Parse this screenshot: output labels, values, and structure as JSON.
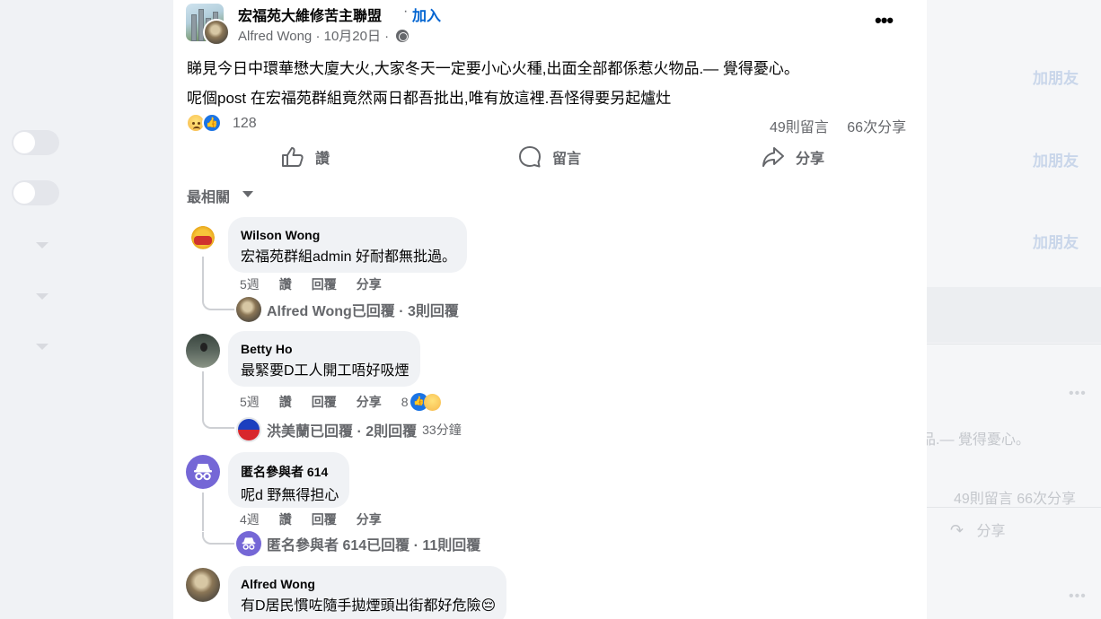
{
  "background": {
    "add_friend_label": "加朋友",
    "preview_text": "品.— 覺得憂心。",
    "preview_stats": "49則留言  66次分享",
    "preview_share": "分享"
  },
  "post": {
    "group_name": "宏福苑大維修苦主聯盟",
    "join_label": "加入",
    "author": "Alfred Wong",
    "date": "10月20日",
    "text_line1": "睇見今日中環華懋大廈大火,大家冬天一定要小心火種,出面全部都係惹火物品.— 覺得憂心。",
    "text_line2": "呢個post 在宏福苑群組竟然兩日都吾批出,唯有放這裡.吾怪得要另起爐灶",
    "reaction_count": "128",
    "comment_count": "49則留言",
    "share_count": "66次分享"
  },
  "actions": {
    "like": "讚",
    "comment": "留言",
    "share": "分享"
  },
  "sort_label": "最相關",
  "comments": [
    {
      "author": "Wilson Wong",
      "text": "宏福苑群組admin 好耐都無批過。",
      "age": "5週",
      "like": "讚",
      "reply": "回覆",
      "share": "分享",
      "replies_summary": "Alfred Wong已回覆 · 3則回覆"
    },
    {
      "author": "Betty Ho",
      "text": "最緊要D工人開工唔好吸煙",
      "age": "5週",
      "like": "讚",
      "reply": "回覆",
      "share": "分享",
      "reactions": "8",
      "replies_summary": "洪美蘭已回覆 · 2則回覆",
      "replies_time": "33分鐘"
    },
    {
      "author": "匿名參與者 614",
      "text": "呢d 野無得担心",
      "age": "4週",
      "like": "讚",
      "reply": "回覆",
      "share": "分享",
      "replies_summary": "匿名參與者 614已回覆 · 11則回覆"
    },
    {
      "author": "Alfred Wong",
      "text": "有D居民慣咗隨手拋煙頭出街都好危險😔"
    }
  ]
}
